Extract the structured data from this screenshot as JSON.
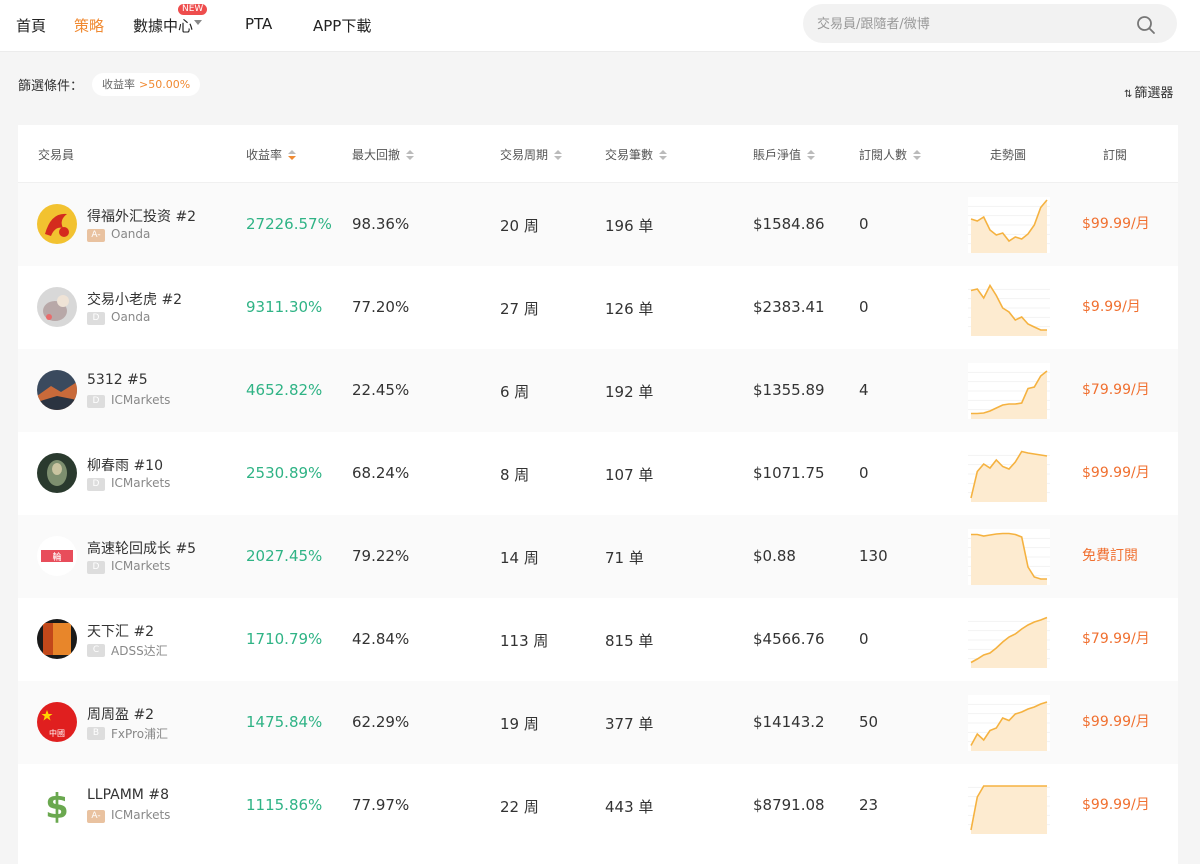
{
  "nav": {
    "home": "首頁",
    "strategy": "策略",
    "data_center": "數據中心",
    "new_badge": "NEW",
    "pta": "PTA",
    "app": "APP下載",
    "search_placeholder": "交易員/跟隨者/微博"
  },
  "filter": {
    "label": "篩選條件：",
    "chip_name": "收益率",
    "chip_value": ">50.00%",
    "filter_button": "篩選器"
  },
  "table": {
    "headers": {
      "trader": "交易員",
      "return": "收益率",
      "drawdown": "最大回撤",
      "period": "交易周期",
      "trades": "交易筆數",
      "equity": "賬戶淨值",
      "subs": "訂閱人數",
      "trend": "走勢圖",
      "subscribe": "訂閱"
    },
    "rows": [
      {
        "name": "得福外汇投资 #2",
        "level": "A-",
        "broker": "Oanda",
        "return": "27226.57%",
        "drawdown": "98.36%",
        "period": "20 周",
        "trades": "196 单",
        "equity": "$1584.86",
        "subs": "0",
        "price": "$99.99/月",
        "trend": [
          0.62,
          0.58,
          0.66,
          0.4,
          0.3,
          0.34,
          0.18,
          0.26,
          0.22,
          0.32,
          0.5,
          0.85,
          1.0
        ]
      },
      {
        "name": "交易小老虎 #2",
        "level": "D",
        "broker": "Oanda",
        "return": "9311.30%",
        "drawdown": "77.20%",
        "period": "27 周",
        "trades": "126 单",
        "equity": "$2383.41",
        "subs": "0",
        "price": "$9.99/月",
        "trend": [
          0.85,
          0.88,
          0.7,
          0.95,
          0.75,
          0.5,
          0.42,
          0.26,
          0.32,
          0.18,
          0.12,
          0.06,
          0.06
        ]
      },
      {
        "name": "5312 #5",
        "level": "D",
        "broker": "ICMarkets",
        "return": "4652.82%",
        "drawdown": "22.45%",
        "period": "6 周",
        "trades": "192 单",
        "equity": "$1355.89",
        "subs": "4",
        "price": "$79.99/月",
        "trend": [
          0.05,
          0.05,
          0.06,
          0.1,
          0.16,
          0.22,
          0.24,
          0.24,
          0.26,
          0.55,
          0.58,
          0.8,
          0.9
        ]
      },
      {
        "name": "柳春雨 #10",
        "level": "D",
        "broker": "ICMarkets",
        "return": "2530.89%",
        "drawdown": "68.24%",
        "period": "8 周",
        "trades": "107 单",
        "equity": "$1071.75",
        "subs": "0",
        "price": "$99.99/月",
        "trend": [
          0.02,
          0.55,
          0.7,
          0.62,
          0.78,
          0.65,
          0.6,
          0.74,
          0.95,
          0.92,
          0.9,
          0.88,
          0.86
        ]
      },
      {
        "name": "高速轮回成长 #5",
        "level": "D",
        "broker": "ICMarkets",
        "return": "2027.45%",
        "drawdown": "79.22%",
        "period": "14 周",
        "trades": "71 单",
        "equity": "$0.88",
        "subs": "130",
        "price": "免費訂閱",
        "trend": [
          0.95,
          0.95,
          0.92,
          0.94,
          0.96,
          0.97,
          0.97,
          0.95,
          0.9,
          0.3,
          0.1,
          0.06,
          0.06
        ]
      },
      {
        "name": "天下汇 #2",
        "level": "C",
        "broker": "ADSS达汇",
        "return": "1710.79%",
        "drawdown": "42.84%",
        "period": "113 周",
        "trades": "815 单",
        "equity": "$4566.76",
        "subs": "0",
        "price": "$79.99/月",
        "trend": [
          0.05,
          0.12,
          0.2,
          0.24,
          0.34,
          0.46,
          0.56,
          0.62,
          0.72,
          0.8,
          0.86,
          0.9,
          0.95
        ]
      },
      {
        "name": "周周盈 #2",
        "level": "B",
        "broker": "FxPro浦汇",
        "return": "1475.84%",
        "drawdown": "62.29%",
        "period": "19 周",
        "trades": "377 单",
        "equity": "$14143.2",
        "subs": "50",
        "price": "$99.99/月",
        "trend": [
          0.05,
          0.28,
          0.16,
          0.35,
          0.4,
          0.6,
          0.55,
          0.68,
          0.72,
          0.78,
          0.82,
          0.88,
          0.92
        ]
      },
      {
        "name": "LLPAMM #8",
        "level": "A-",
        "broker": "ICMarkets",
        "return": "1115.86%",
        "drawdown": "77.97%",
        "period": "22 周",
        "trades": "443 单",
        "equity": "$8791.08",
        "subs": "23",
        "price": "$99.99/月",
        "trend": [
          0.02,
          0.68,
          0.9,
          0.9,
          0.9,
          0.9,
          0.9,
          0.9,
          0.9,
          0.9,
          0.9,
          0.9,
          0.9
        ]
      }
    ]
  },
  "colors": {
    "accent": "#f08a32",
    "positive": "#2fb385",
    "price": "#f07030",
    "spark_line": "#f5b240"
  }
}
